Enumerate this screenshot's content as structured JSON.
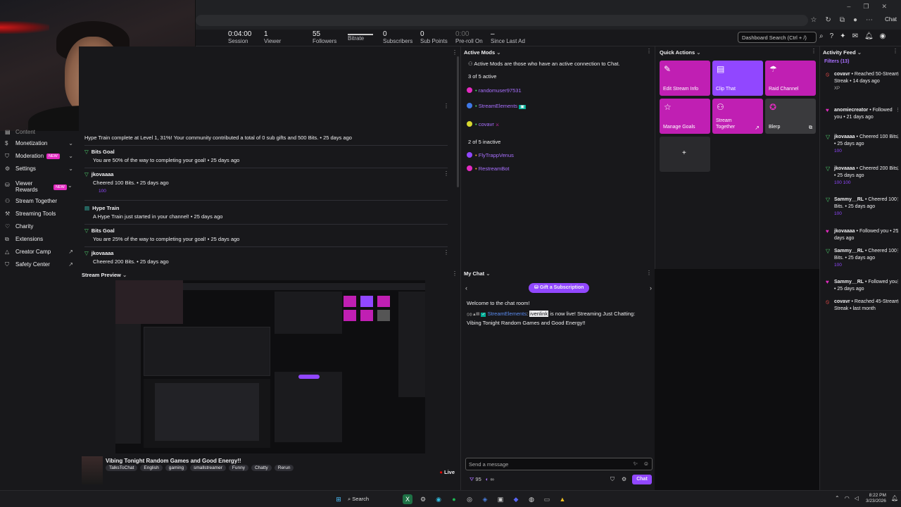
{
  "browser": {
    "chat_label": "Chat",
    "win_min": "–",
    "win_max": "❐",
    "win_close": "✕"
  },
  "stats": {
    "session": {
      "value": "0:04:00",
      "label": "Session"
    },
    "viewer": {
      "value": "1",
      "label": "Viewer"
    },
    "followers": {
      "value": "55",
      "label": "Followers"
    },
    "bitrate": {
      "label": "Bitrate"
    },
    "subscribers": {
      "value": "0",
      "label": "Subscribers"
    },
    "subpoints": {
      "value": "0",
      "label": "Sub Points"
    },
    "preroll": {
      "value": "0:00",
      "label": "Pre-roll On"
    },
    "lastad": {
      "value": "–",
      "label": "Since Last Ad"
    },
    "search_placeholder": "Dashboard Search (Ctrl + /)"
  },
  "sidebar": {
    "items": [
      {
        "label": "Content"
      },
      {
        "label": "Monetization"
      },
      {
        "label": "Moderation",
        "badge": "NEW"
      },
      {
        "label": "Settings"
      },
      {
        "label": "Viewer Rewards",
        "badge": "NEW"
      },
      {
        "label": "Stream Together"
      },
      {
        "label": "Streaming Tools"
      },
      {
        "label": "Charity"
      },
      {
        "label": "Extensions"
      },
      {
        "label": "Creator Camp"
      },
      {
        "label": "Safety Center"
      }
    ]
  },
  "feed": {
    "items": [
      {
        "title": "",
        "text": "Hype Train complete at Level 1, 31%! Your community contributed a total of 0 sub gifts and 500 Bits.",
        "time": "• 25 days ago"
      },
      {
        "title": "Bits Goal",
        "text": "You are 50% of the way to completing your goal!",
        "time": "• 25 days ago"
      },
      {
        "title": "jkovaaaa",
        "text": "Cheered 100 Bits.",
        "time": "• 25 days ago",
        "bits": "100"
      },
      {
        "title": "Hype Train",
        "text": "A Hype Train just started in your channel!",
        "time": "• 25 days ago"
      },
      {
        "title": "Bits Goal",
        "text": "You are 25% of the way to completing your goal!",
        "time": "• 25 days ago"
      },
      {
        "title": "jkovaaaa",
        "text": "Cheered 200 Bits.",
        "time": "• 25 days ago"
      }
    ]
  },
  "preview": {
    "header": "Stream Preview",
    "title": "Vibing Tonight Random Games and Good Energy!!",
    "tags": [
      "TalksToChat",
      "English",
      "gaming",
      "smallstreamer",
      "Funny",
      "Chatty",
      "Rerun"
    ],
    "live": "Live"
  },
  "mods": {
    "header": "Active Mods",
    "desc": "Active Mods are those who have an active connection to Chat.",
    "active_count": "3 of 5 active",
    "active": [
      "randomuser97531",
      "StreamElements",
      "covavr"
    ],
    "inactive_count": "2 of 5 inactive",
    "inactive": [
      "FlyTrappVenus",
      "RestreamBot"
    ]
  },
  "quick": {
    "header": "Quick Actions",
    "actions": [
      {
        "label": "Edit Stream Info",
        "icon": "pencil-icon"
      },
      {
        "label": "Clip That",
        "icon": "clapper-icon"
      },
      {
        "label": "Raid Channel",
        "icon": "raid-icon"
      },
      {
        "label": "Manage Goals",
        "icon": "star-icon"
      },
      {
        "label": "Stream Together",
        "icon": "add-person-icon"
      },
      {
        "label": "Blerp",
        "icon": "blerp-icon"
      }
    ],
    "add": "+"
  },
  "chat": {
    "header": "My Chat",
    "gift": "Gift a Subscription",
    "welcome": "Welcome to the chat room!",
    "msg_user": "StreamElements",
    "msg_mention": "ivenlink",
    "msg_text": "is now live! Streaming Just Chatting: Vibing Tonight Random Games and Good Energy!!",
    "input_placeholder": "Send a message",
    "points": "95",
    "infinity": "∞",
    "send": "Chat"
  },
  "activity": {
    "header": "Activity Feed",
    "filters": "Filters (13)",
    "items": [
      {
        "user": "covavr",
        "text": "• Reached 50-Stream Streak • 14 days ago",
        "extra": "XP",
        "icon": "red"
      },
      {
        "user": "anomiecreator",
        "text": "• Followed you • 21 days ago",
        "icon": "pink"
      },
      {
        "user": "jkovaaaa",
        "text": "• Cheered 100 Bits. • 25 days ago",
        "bits": "100",
        "icon": "green"
      },
      {
        "user": "jkovaaaa",
        "text": "• Cheered 200 Bits. • 25 days ago",
        "bits": "100 100",
        "icon": "green"
      },
      {
        "user": "Sammy__RL",
        "text": "• Cheered 100 Bits. • 25 days ago",
        "bits": "100",
        "icon": "green"
      },
      {
        "user": "jkovaaaa",
        "text": "• Followed you • 25 days ago",
        "icon": "pink"
      },
      {
        "user": "Sammy__RL",
        "text": "• Cheered 100 Bits. • 25 days ago",
        "bits": "100",
        "icon": "green"
      },
      {
        "user": "Sammy__RL",
        "text": "• Followed you • 25 days ago",
        "icon": "pink"
      },
      {
        "user": "covavr",
        "text": "• Reached 45-Stream Streak • last month",
        "icon": "red"
      }
    ]
  },
  "taskbar": {
    "search": "Search",
    "time": "8:22 PM",
    "date": "3/23/2026"
  }
}
